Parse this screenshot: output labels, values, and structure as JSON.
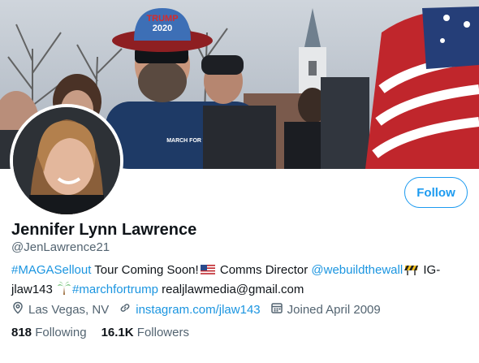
{
  "profile": {
    "name": "Jennifer Lynn Lawrence",
    "handle": "@JenLawrence21",
    "follow_label": "Follow"
  },
  "bio": {
    "hashtag1": "#MAGASellout",
    "text1": " Tour Coming Soon!",
    "text2": " Comms Director ",
    "mention": "@webuildthewall",
    "text3": " IG-",
    "text4": "jlaw143 ",
    "hashtag2": "#marchfortrump",
    "email": " realjlawmedia@gmail.com"
  },
  "meta": {
    "location": "Las Vegas, NV",
    "website": "instagram.com/jlaw143",
    "joined": "Joined April 2009"
  },
  "stats": {
    "following_count": "818",
    "following_label": "Following",
    "followers_count": "16.1K",
    "followers_label": "Followers"
  },
  "banner": {
    "hat_text_top": "TRUMP",
    "hat_text_bottom": "2020",
    "jacket_text": "MARCH FOR TRUMP"
  },
  "colors": {
    "accent": "#1d9bf0",
    "link": "#1b95e0",
    "secondary_text": "#536471"
  },
  "icons": [
    "location-icon",
    "link-icon",
    "calendar-icon",
    "us-flag-emoji",
    "construction-emoji",
    "palm-tree-emoji"
  ]
}
